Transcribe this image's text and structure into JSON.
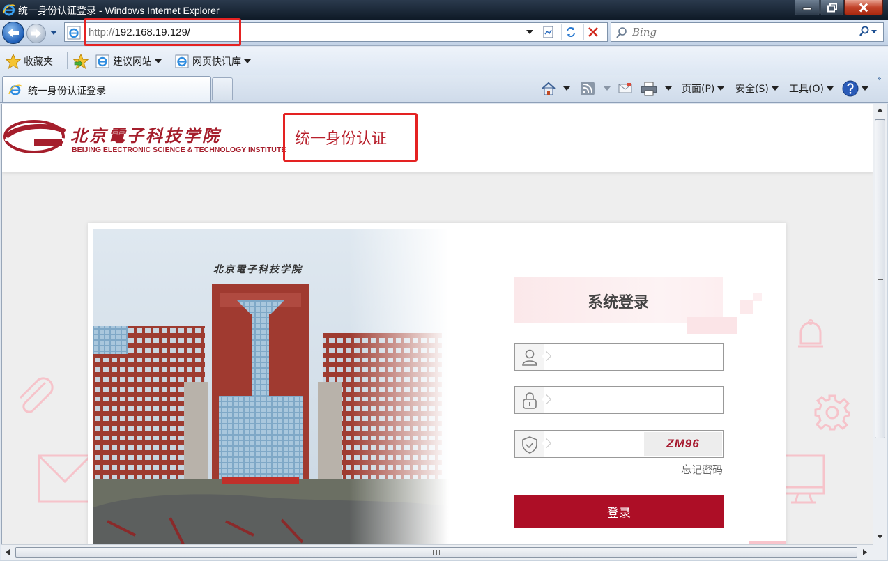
{
  "window": {
    "title": "统一身份认证登录 - Windows Internet Explorer"
  },
  "nav": {
    "url_scheme": "http://",
    "url_host": "192.168.19.129/",
    "search_placeholder": "Bing"
  },
  "favorites": {
    "favorites_label": "收藏夹",
    "suggested_sites": "建议网站",
    "web_slice": "网页快讯库"
  },
  "tab": {
    "title": "统一身份认证登录"
  },
  "commandbar": {
    "page": "页面(P)",
    "safety": "安全(S)",
    "tools": "工具(O)"
  },
  "site": {
    "logo_cn": "北京電子科技学院",
    "logo_en": "BEIJING ELECTRONIC SCIENCE & TECHNOLOGY INSTITUTE",
    "system_title": "统一身份认证",
    "campus_sign": "北京電子科技学院"
  },
  "login": {
    "heading": "系统登录",
    "username_value": "",
    "password_value": "",
    "captcha_value": "",
    "captcha_code": "ZM96",
    "forgot_password": "忘记密码",
    "submit": "登录"
  },
  "colors": {
    "brand": "#ad0e26",
    "highlight": "#e42222",
    "heading_bg": "#fbe8ea"
  },
  "icons": {
    "user": "user-icon",
    "lock": "lock-icon",
    "shield": "shield-check-icon",
    "home": "home-icon",
    "feed": "rss-icon",
    "mail": "read-mail-icon",
    "print": "printer-icon",
    "help": "help-icon"
  }
}
